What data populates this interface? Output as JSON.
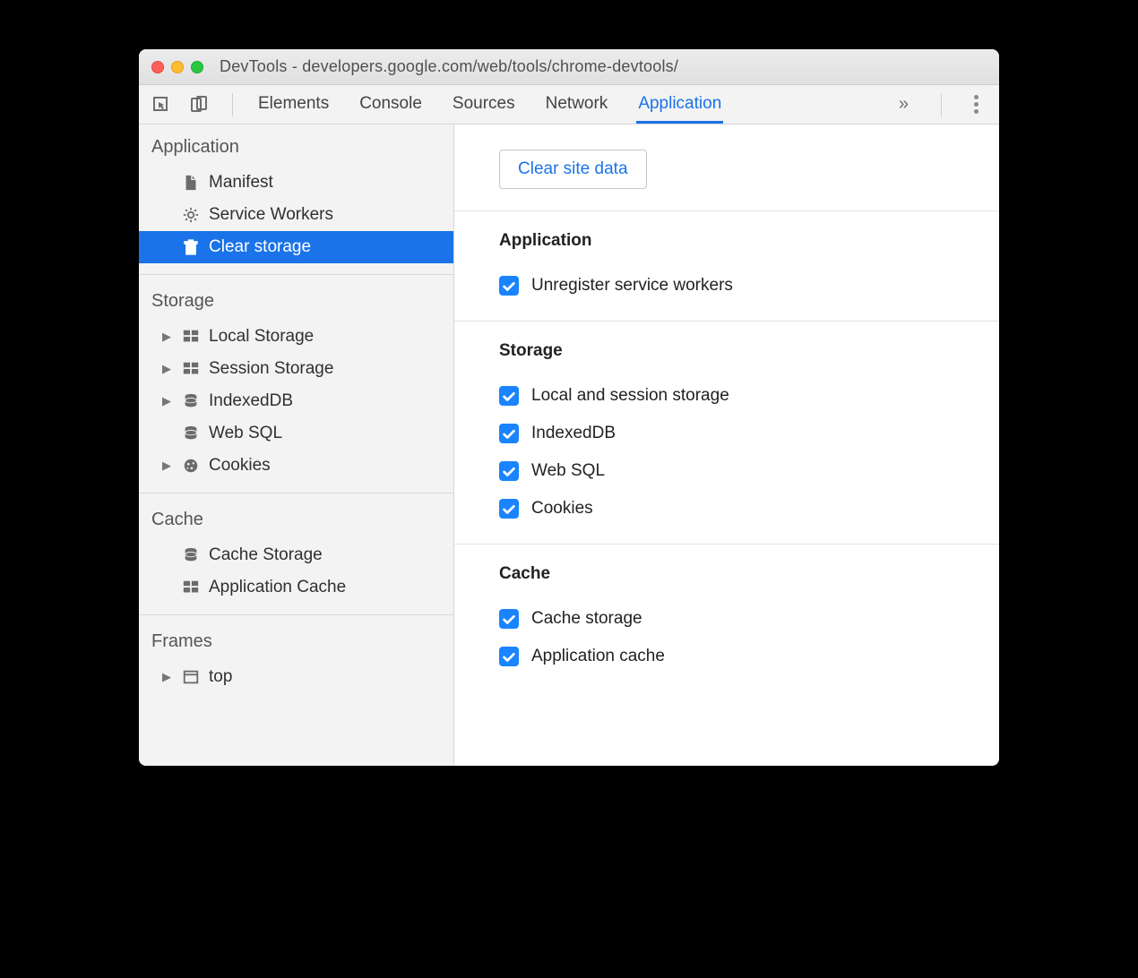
{
  "window": {
    "title": "DevTools - developers.google.com/web/tools/chrome-devtools/"
  },
  "toolbar": {
    "tabs": [
      "Elements",
      "Console",
      "Sources",
      "Network",
      "Application"
    ],
    "active_tab": "Application"
  },
  "sidebar": {
    "groups": [
      {
        "title": "Application",
        "items": [
          {
            "label": "Manifest",
            "icon": "file-icon"
          },
          {
            "label": "Service Workers",
            "icon": "gear-icon"
          },
          {
            "label": "Clear storage",
            "icon": "trash-icon",
            "selected": true
          }
        ]
      },
      {
        "title": "Storage",
        "items": [
          {
            "label": "Local Storage",
            "icon": "grid-icon",
            "expandable": true
          },
          {
            "label": "Session Storage",
            "icon": "grid-icon",
            "expandable": true
          },
          {
            "label": "IndexedDB",
            "icon": "database-icon",
            "expandable": true
          },
          {
            "label": "Web SQL",
            "icon": "database-icon"
          },
          {
            "label": "Cookies",
            "icon": "cookie-icon",
            "expandable": true
          }
        ]
      },
      {
        "title": "Cache",
        "items": [
          {
            "label": "Cache Storage",
            "icon": "database-icon"
          },
          {
            "label": "Application Cache",
            "icon": "grid-icon"
          }
        ]
      },
      {
        "title": "Frames",
        "items": [
          {
            "label": "top",
            "icon": "frame-icon",
            "expandable": true
          }
        ]
      }
    ]
  },
  "main": {
    "clear_button": "Clear site data",
    "sections": [
      {
        "title": "Application",
        "checks": [
          {
            "label": "Unregister service workers",
            "checked": true
          }
        ]
      },
      {
        "title": "Storage",
        "checks": [
          {
            "label": "Local and session storage",
            "checked": true
          },
          {
            "label": "IndexedDB",
            "checked": true
          },
          {
            "label": "Web SQL",
            "checked": true
          },
          {
            "label": "Cookies",
            "checked": true
          }
        ]
      },
      {
        "title": "Cache",
        "checks": [
          {
            "label": "Cache storage",
            "checked": true
          },
          {
            "label": "Application cache",
            "checked": true
          }
        ]
      }
    ]
  }
}
